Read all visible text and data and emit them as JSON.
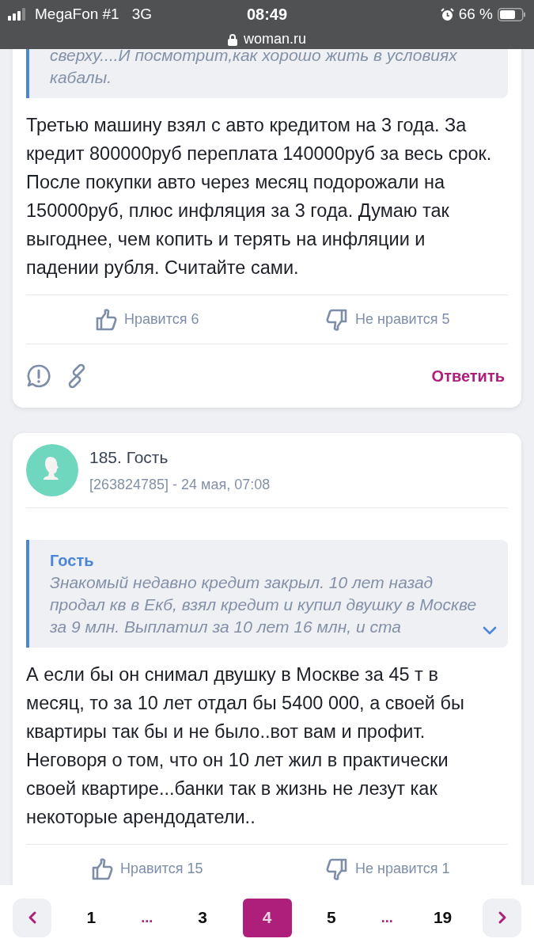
{
  "status_bar": {
    "carrier": "MegaFon #1",
    "network": "3G",
    "time": "08:49",
    "battery_percent": "66 %",
    "url": "woman.ru"
  },
  "posts": [
    {
      "quote": {
        "text": "сверху....И посмотрит,как хорошо жить в условиях кабалы.",
        "collapsed": false
      },
      "body": "Третью машину взял с авто кредитом на 3 года. За кредит 800000руб переплата 140000руб за весь срок. После покупки авто через месяц подорожали на 150000руб, плюс инфляция за 3 года. Думаю так выгоднее, чем копить и терять на инфляции и падении рубля. Считайте сами.",
      "likes": "Нравится 6",
      "dislikes": "Не нравится 5",
      "reply": "Ответить"
    },
    {
      "header": {
        "title": "185. Гость",
        "meta": "[263824785] - 24 мая, 07:08"
      },
      "quote": {
        "author": "Гость",
        "text": "Знакомый недавно кредит закрыл. 10 лет назад продал кв в Екб, взял кредит и купил двушку в Москве за 9 млн. Выплатил за 10 лет 16 млн, и ста",
        "collapsed": true
      },
      "body": "А если бы он снимал двушку в Москве за 45 т в месяц, то за 10 лет отдал бы 5400 000, а своей бы квартиры так бы и не было..вот вам и профит. Неговоря о том, что он 10 лет жил в практически своей квартире...банки так в жизнь не лезут как некоторые арендодатели..",
      "likes": "Нравится 15",
      "dislikes": "Не нравится 1"
    }
  ],
  "pagination": [
    {
      "kind": "prev"
    },
    {
      "kind": "page",
      "label": "1",
      "selected": false
    },
    {
      "kind": "ellipsis",
      "label": "..."
    },
    {
      "kind": "page",
      "label": "3",
      "selected": false
    },
    {
      "kind": "page",
      "label": "4",
      "selected": true
    },
    {
      "kind": "page",
      "label": "5",
      "selected": false
    },
    {
      "kind": "ellipsis",
      "label": "..."
    },
    {
      "kind": "page",
      "label": "19",
      "selected": false
    },
    {
      "kind": "next"
    }
  ]
}
